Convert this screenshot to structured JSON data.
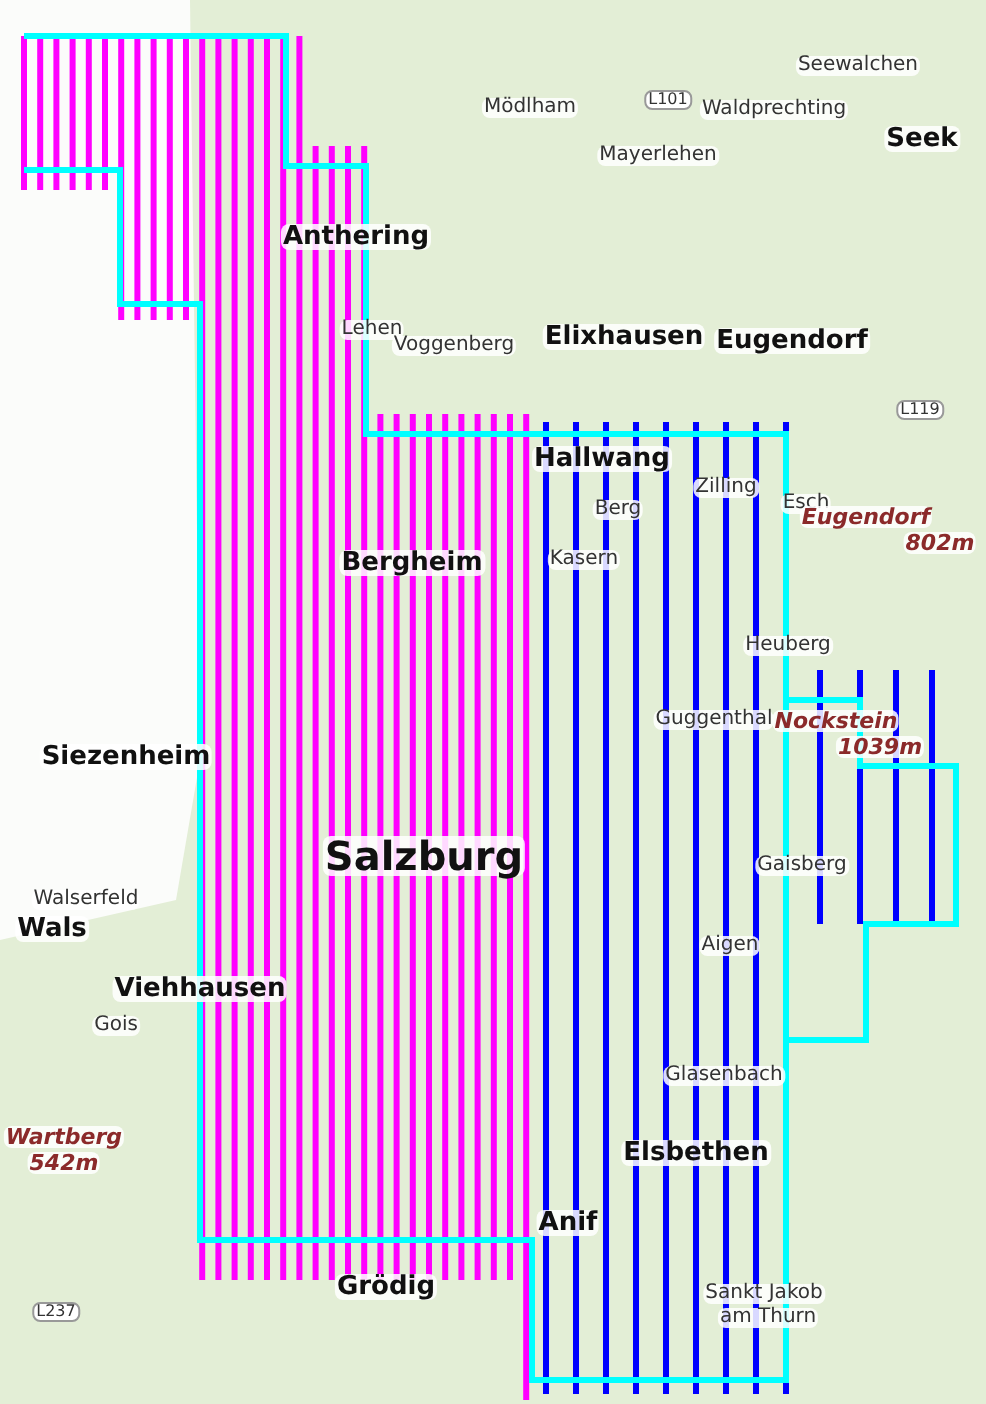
{
  "map": {
    "places": [
      {
        "name": "Seewalchen",
        "kind": "village"
      },
      {
        "name": "Mödlham",
        "kind": "village"
      },
      {
        "name": "L101",
        "kind": "road"
      },
      {
        "name": "Waldprechting",
        "kind": "village"
      },
      {
        "name": "Seek",
        "kind": "town"
      },
      {
        "name": "Mayerlehen",
        "kind": "village"
      },
      {
        "name": "Anthering",
        "kind": "town"
      },
      {
        "name": "Lehen",
        "kind": "village"
      },
      {
        "name": "Voggenberg",
        "kind": "village"
      },
      {
        "name": "Elixhausen",
        "kind": "town"
      },
      {
        "name": "Eugendorf",
        "kind": "town"
      },
      {
        "name": "L119",
        "kind": "road"
      },
      {
        "name": "Hallwang",
        "kind": "town"
      },
      {
        "name": "Zilling",
        "kind": "village"
      },
      {
        "name": "Esch",
        "kind": "village"
      },
      {
        "name": "Eugendorf",
        "kind": "peak"
      },
      {
        "name": "802m",
        "kind": "peak"
      },
      {
        "name": "Berg",
        "kind": "village"
      },
      {
        "name": "Bergheim",
        "kind": "town"
      },
      {
        "name": "Kasern",
        "kind": "village"
      },
      {
        "name": "Heuberg",
        "kind": "village"
      },
      {
        "name": "Guggenthal",
        "kind": "village"
      },
      {
        "name": "Nockstein",
        "kind": "peak"
      },
      {
        "name": "1039m",
        "kind": "peak"
      },
      {
        "name": "Siezenheim",
        "kind": "town"
      },
      {
        "name": "Salzburg",
        "kind": "city"
      },
      {
        "name": "Gaisberg",
        "kind": "village"
      },
      {
        "name": "Walserfeld",
        "kind": "village"
      },
      {
        "name": "Wals",
        "kind": "town"
      },
      {
        "name": "Aigen",
        "kind": "village"
      },
      {
        "name": "Viehhausen",
        "kind": "town"
      },
      {
        "name": "Gois",
        "kind": "village"
      },
      {
        "name": "Glasenbach",
        "kind": "village"
      },
      {
        "name": "Wartberg",
        "kind": "peak"
      },
      {
        "name": "542m",
        "kind": "peak"
      },
      {
        "name": "Elsbethen",
        "kind": "town"
      },
      {
        "name": "Anif",
        "kind": "town"
      },
      {
        "name": "Grödig",
        "kind": "town"
      },
      {
        "name": "L237",
        "kind": "road"
      },
      {
        "name": "Sankt Jakob",
        "kind": "village"
      },
      {
        "name": "am Thurn",
        "kind": "village"
      }
    ]
  }
}
